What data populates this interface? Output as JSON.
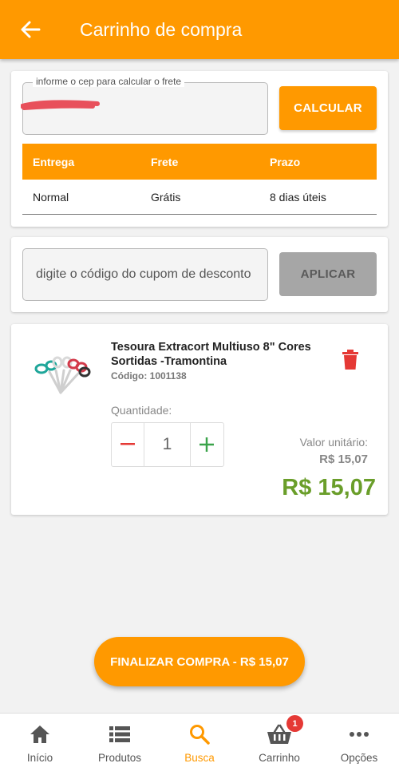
{
  "header": {
    "title": "Carrinho de compra"
  },
  "shipping": {
    "cep_label": "informe o cep para calcular o frete",
    "calc_button": "CALCULAR",
    "columns": [
      "Entrega",
      "Frete",
      "Prazo"
    ],
    "rows": [
      {
        "entrega": "Normal",
        "frete": "Grátis",
        "prazo": "8 dias úteis"
      }
    ]
  },
  "coupon": {
    "placeholder": "digite o código do cupom de desconto",
    "apply_button": "APLICAR"
  },
  "product": {
    "name": "Tesoura Extracort Multiuso 8\" Cores Sortidas -Tramontina",
    "code": "Código: 1001138",
    "quantity_label": "Quantidade:",
    "quantity": "1",
    "unit_label": "Valor unitário:",
    "unit_price": "R$ 15,07",
    "total": "R$ 15,07"
  },
  "checkout": {
    "button": "FINALIZAR COMPRA - R$ 15,07"
  },
  "bottom_nav": {
    "items": [
      {
        "label": "Início",
        "icon": "home-icon"
      },
      {
        "label": "Produtos",
        "icon": "list-icon"
      },
      {
        "label": "Busca",
        "icon": "search-icon",
        "active": true
      },
      {
        "label": "Carrinho",
        "icon": "basket-icon",
        "badge": "1"
      },
      {
        "label": "Opções",
        "icon": "more-icon"
      }
    ]
  },
  "colors": {
    "primary": "#ff9900",
    "price_green": "#6a9e2a",
    "delete_red": "#e53935",
    "badge_red": "#e53935"
  }
}
